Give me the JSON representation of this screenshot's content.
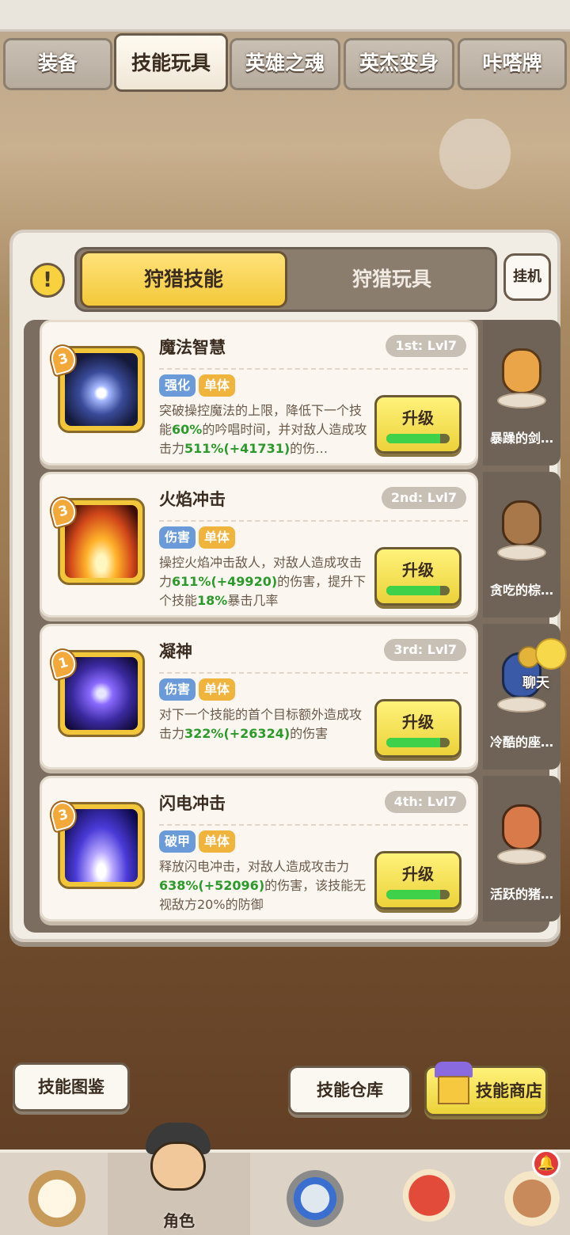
{
  "top_tabs": [
    {
      "label": "装备"
    },
    {
      "label": "技能玩具",
      "active": true
    },
    {
      "label": "英雄之魂"
    },
    {
      "label": "英杰变身"
    },
    {
      "label": "咔嗒牌"
    }
  ],
  "panel": {
    "warn_icon": "!",
    "seg_active": "狩猎技能",
    "seg_inactive": "狩猎玩具",
    "idle_label": "挂机"
  },
  "skills": [
    {
      "name": "魔法智慧",
      "rank": "1st: Lvl7",
      "level": "3",
      "tags": [
        "强化",
        "单体"
      ],
      "desc_parts": [
        "突破操控魔法的上限，降低下一个技能",
        "60%",
        "的吟唱时间，并对敌人造成攻击力",
        "511%(+41731)",
        "的伤…"
      ],
      "upgrade_label": "升级",
      "progress": 0.85,
      "companion": "暴躁的剑…"
    },
    {
      "name": "火焰冲击",
      "rank": "2nd: Lvl7",
      "level": "3",
      "tags": [
        "伤害",
        "单体"
      ],
      "desc_parts": [
        "操控火焰冲击敌人，对敌人造成攻击力",
        "611%(+49920)",
        "的伤害，提升下个技能",
        "18%",
        "暴击几率"
      ],
      "upgrade_label": "升级",
      "progress": 0.85,
      "companion": "贪吃的棕…"
    },
    {
      "name": "凝神",
      "rank": "3rd: Lvl7",
      "level": "1",
      "tags": [
        "伤害",
        "单体"
      ],
      "desc_parts": [
        "对下一个技能的首个目标额外造成攻击力",
        "322%(+26324)",
        "的伤害",
        "",
        ""
      ],
      "upgrade_label": "升级",
      "progress": 0.85,
      "companion": "冷酷的座…"
    },
    {
      "name": "闪电冲击",
      "rank": "4th: Lvl7",
      "level": "3",
      "tags": [
        "破甲",
        "单体"
      ],
      "desc_parts": [
        "释放闪电冲击，对敌人造成攻击力",
        "638%(+52096)",
        "的伤害，该技能无视敌方20%的防御",
        "",
        ""
      ],
      "upgrade_label": "升级",
      "progress": 0.85,
      "companion": "活跃的猪…"
    }
  ],
  "chat_label": "聊天",
  "bottom_buttons": {
    "codex": "技能图鉴",
    "storage": "技能仓库",
    "shop": "技能商店"
  },
  "nav": {
    "active_label": "角色",
    "items": [
      "caveman-icon",
      "hero-icon",
      "sword-icon",
      "dino-icon",
      "totem-icon"
    ]
  },
  "colors": {
    "accent_yellow": "#f3c93a",
    "progress_green": "#3fd14a",
    "value_green": "#2c9a2a",
    "tag_blue": "#6a9bd8",
    "tag_orange": "#f0b33b"
  }
}
